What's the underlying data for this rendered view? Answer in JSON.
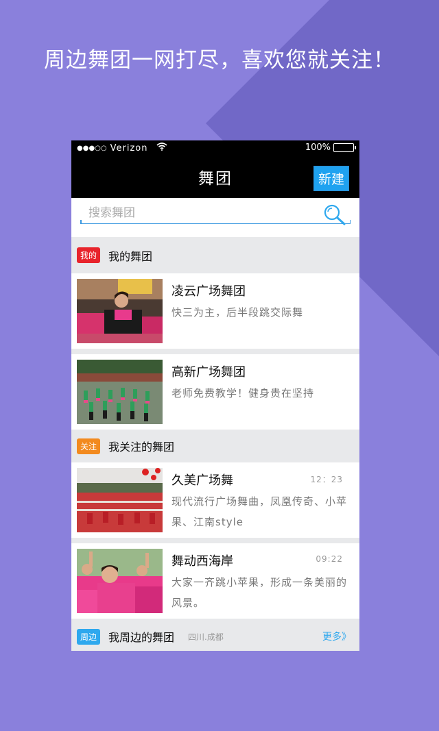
{
  "slogan": "周边舞团一网打尽，喜欢您就关注！",
  "status_bar": {
    "signal": "●●●○○",
    "carrier": "Verizon",
    "battery": "100%"
  },
  "nav": {
    "title": "舞团",
    "new_button": "新建"
  },
  "search": {
    "placeholder": "搜索舞团"
  },
  "sections": {
    "mine": {
      "tag": "我的",
      "title": "我的舞团"
    },
    "followed": {
      "tag": "关注",
      "title": "我关注的舞团"
    },
    "nearby": {
      "tag": "周边",
      "title": "我周边的舞团",
      "location": "四川.成都",
      "more": "更多》"
    }
  },
  "my_troupes": [
    {
      "name": "凌云广场舞团",
      "desc": "快三为主，后半段跳交际舞"
    },
    {
      "name": "高新广场舞团",
      "desc": "老师免费教学！健身贵在坚持"
    }
  ],
  "followed_troupes": [
    {
      "name": "久美广场舞",
      "desc": "现代流行广场舞曲，凤凰传奇、小苹果、江南style",
      "time": "12：23"
    },
    {
      "name": "舞动西海岸",
      "desc": "大家一齐跳小苹果，形成一条美丽的风景。",
      "time": "09:22"
    }
  ],
  "colors": {
    "background": "#8A80DC",
    "accent_blue": "#1FA2F0",
    "tag_red": "#E8242C",
    "tag_orange": "#F28A1F",
    "tag_blue": "#2EA8EE"
  },
  "icons": {
    "search": "search-icon",
    "wifi": "wifi-icon",
    "battery": "battery-icon"
  }
}
